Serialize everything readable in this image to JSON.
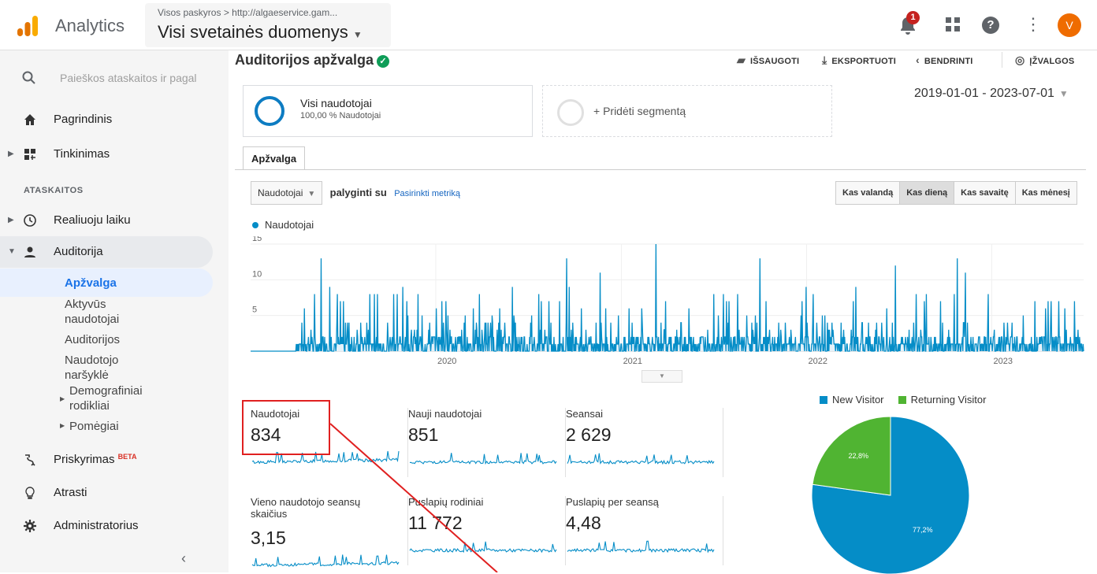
{
  "app": {
    "title": "Analytics"
  },
  "account": {
    "breadcrumb": "Visos paskyros > http://algaeservice.gam...",
    "view": "Visi svetainės duomenys"
  },
  "topbar": {
    "notification_count": "1",
    "avatar_letter": "V"
  },
  "sidebar": {
    "search_placeholder": "Paieškos ataskaitos ir pagal",
    "home": "Pagrindinis",
    "customization": "Tinkinimas",
    "reports_section": "ATASKAITOS",
    "realtime": "Realiuoju laiku",
    "audience": "Auditorija",
    "audience_items": [
      "Apžvalga",
      "Aktyvūs naudotojai",
      "Auditorijos",
      "Naudotojo naršyklė",
      "Demografiniai rodikliai",
      "Pomėgiai"
    ],
    "attribution": "Priskyrimas",
    "attribution_badge": "BETA",
    "discover": "Atrasti",
    "admin": "Administratorius"
  },
  "main": {
    "title": "Auditorijos apžvalga",
    "toolbar": {
      "save": "IŠSAUGOTI",
      "export": "EKSPORTUOTI",
      "share": "BENDRINTI",
      "insights": "ĮŽVALGOS"
    },
    "segment": {
      "name": "Visi naudotojai",
      "sub": "100,00 % Naudotojai",
      "add": "+ Pridėti segmentą"
    },
    "date_range": "2019-01-01 - 2023-07-01",
    "tab": "Apžvalga",
    "metric_select": "Naudotojai",
    "compare_label": "palyginti su",
    "choose_metric": "Pasirinkti metriką",
    "granularity": [
      "Kas valandą",
      "Kas dieną",
      "Kas savaitę",
      "Kas mėnesį"
    ],
    "granularity_selected": "Kas dieną"
  },
  "chart_data": [
    {
      "type": "line",
      "title": "",
      "series": [
        {
          "name": "Naudotojai"
        }
      ],
      "x_ticks": [
        "2020",
        "2021",
        "2022",
        "2023"
      ],
      "y_ticks": [
        "5",
        "10",
        "15"
      ],
      "ylim": [
        0,
        15
      ],
      "x_range": [
        "2019-01-01",
        "2023-07-01"
      ],
      "spikes": [
        {
          "x": "2019-05-20",
          "y": 13
        },
        {
          "x": "2020-09-15",
          "y": 13
        },
        {
          "x": "2020-11-20",
          "y": 11
        },
        {
          "x": "2021-03-10",
          "y": 15
        },
        {
          "x": "2021-10-01",
          "y": 13
        },
        {
          "x": "2022-06-25",
          "y": 12
        },
        {
          "x": "2022-10-25",
          "y": 13
        },
        {
          "x": "2022-11-10",
          "y": 11
        }
      ],
      "baseline_typical": 1
    },
    {
      "type": "pie",
      "labels": [
        "New Visitor",
        "Returning Visitor"
      ],
      "values": [
        77.2,
        22.8
      ],
      "value_labels": [
        "77,2%",
        "22,8%"
      ],
      "colors": [
        "#058dc7",
        "#50b432"
      ]
    }
  ],
  "metrics": [
    {
      "label": "Naudotojai",
      "value": "834"
    },
    {
      "label": "Nauji naudotojai",
      "value": "851"
    },
    {
      "label": "Seansai",
      "value": "2 629"
    },
    {
      "label": "Vieno naudotojo seansų skaičius",
      "value": "3,15"
    },
    {
      "label": "Puslapių rodiniai",
      "value": "11 772"
    },
    {
      "label": "Puslapių per seansą",
      "value": "4,48"
    }
  ],
  "colors": {
    "accent": "#058dc7",
    "returning": "#50b432",
    "highlight": "#e02020"
  }
}
